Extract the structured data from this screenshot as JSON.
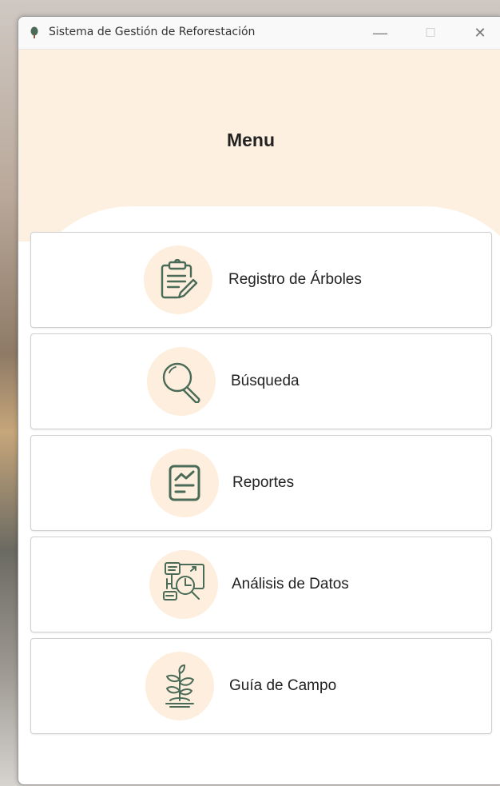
{
  "window": {
    "title": "Sistema de Gestión de Reforestación",
    "minimize_glyph": "—",
    "maximize_glyph": "☐",
    "close_glyph": "✕"
  },
  "menu": {
    "title": "Menu",
    "items": [
      {
        "label": "Registro de Árboles",
        "icon": "clipboard-edit-icon"
      },
      {
        "label": "Búsqueda",
        "icon": "magnifier-icon"
      },
      {
        "label": "Reportes",
        "icon": "report-chart-icon"
      },
      {
        "label": "Análisis de Datos",
        "icon": "data-analysis-icon"
      },
      {
        "label": "Guía de Campo",
        "icon": "plant-sprout-icon"
      }
    ]
  },
  "colors": {
    "header_bg": "#fdf0e0",
    "icon_circle": "#fdeedd",
    "icon_stroke": "#4a6b57"
  }
}
